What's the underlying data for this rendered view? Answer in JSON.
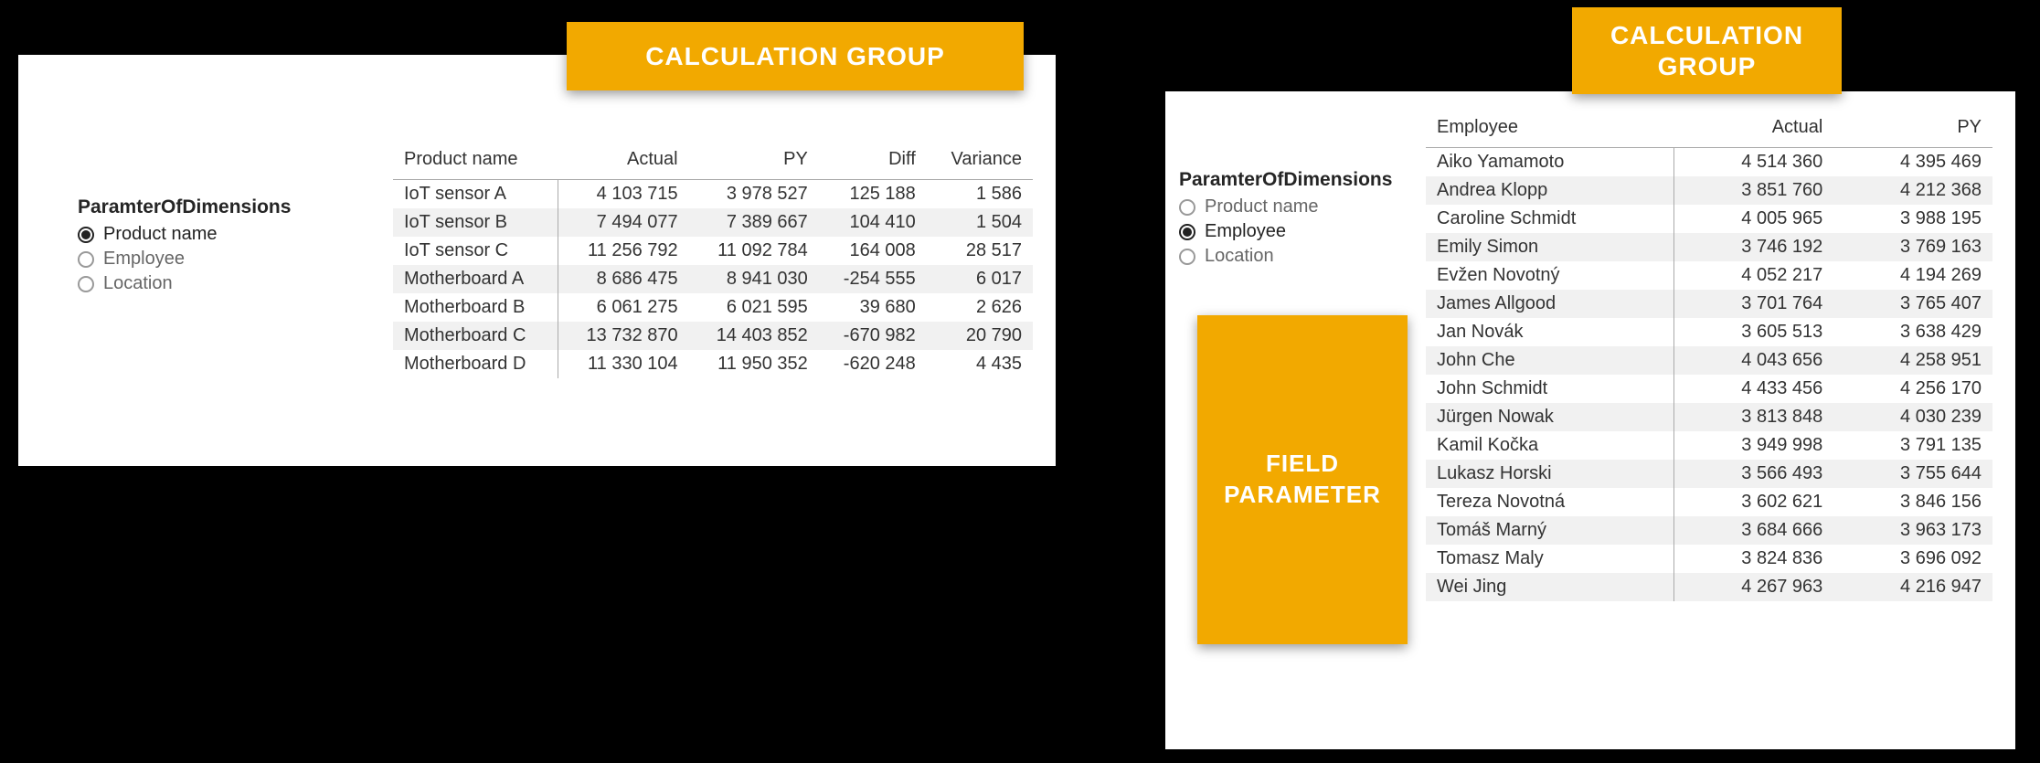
{
  "tags": {
    "calc_group": "CALCULATION GROUP",
    "field_param": "FIELD PARAMETER"
  },
  "slicer": {
    "title": "ParamterOfDimensions",
    "options": [
      "Product name",
      "Employee",
      "Location"
    ]
  },
  "left_table": {
    "headers": [
      "Product name",
      "Actual",
      "PY",
      "Diff",
      "Variance"
    ],
    "rows": [
      [
        "IoT sensor A",
        "4 103 715",
        "3 978 527",
        "125 188",
        "1 586"
      ],
      [
        "IoT sensor B",
        "7 494 077",
        "7 389 667",
        "104 410",
        "1 504"
      ],
      [
        "IoT sensor C",
        "11 256 792",
        "11 092 784",
        "164 008",
        "28 517"
      ],
      [
        "Motherboard A",
        "8 686 475",
        "8 941 030",
        "-254 555",
        "6 017"
      ],
      [
        "Motherboard B",
        "6 061 275",
        "6 021 595",
        "39 680",
        "2 626"
      ],
      [
        "Motherboard C",
        "13 732 870",
        "14 403 852",
        "-670 982",
        "20 790"
      ],
      [
        "Motherboard D",
        "11 330 104",
        "11 950 352",
        "-620 248",
        "4 435"
      ]
    ]
  },
  "right_table": {
    "headers": [
      "Employee",
      "Actual",
      "PY"
    ],
    "rows": [
      [
        "Aiko Yamamoto",
        "4 514 360",
        "4 395 469"
      ],
      [
        "Andrea Klopp",
        "3 851 760",
        "4 212 368"
      ],
      [
        "Caroline Schmidt",
        "4 005 965",
        "3 988 195"
      ],
      [
        "Emily Simon",
        "3 746 192",
        "3 769 163"
      ],
      [
        "Evžen Novotný",
        "4 052 217",
        "4 194 269"
      ],
      [
        "James Allgood",
        "3 701 764",
        "3 765 407"
      ],
      [
        "Jan Novák",
        "3 605 513",
        "3 638 429"
      ],
      [
        "John Che",
        "4 043 656",
        "4 258 951"
      ],
      [
        "John Schmidt",
        "4 433 456",
        "4 256 170"
      ],
      [
        "Jürgen Nowak",
        "3 813 848",
        "4 030 239"
      ],
      [
        "Kamil Kočka",
        "3 949 998",
        "3 791 135"
      ],
      [
        "Lukasz Horski",
        "3 566 493",
        "3 755 644"
      ],
      [
        "Tereza Novotná",
        "3 602 621",
        "3 846 156"
      ],
      [
        "Tomáš Marný",
        "3 684 666",
        "3 963 173"
      ],
      [
        "Tomasz Maly",
        "3 824 836",
        "3 696 092"
      ],
      [
        "Wei Jing",
        "4 267 963",
        "4 216 947"
      ]
    ]
  }
}
